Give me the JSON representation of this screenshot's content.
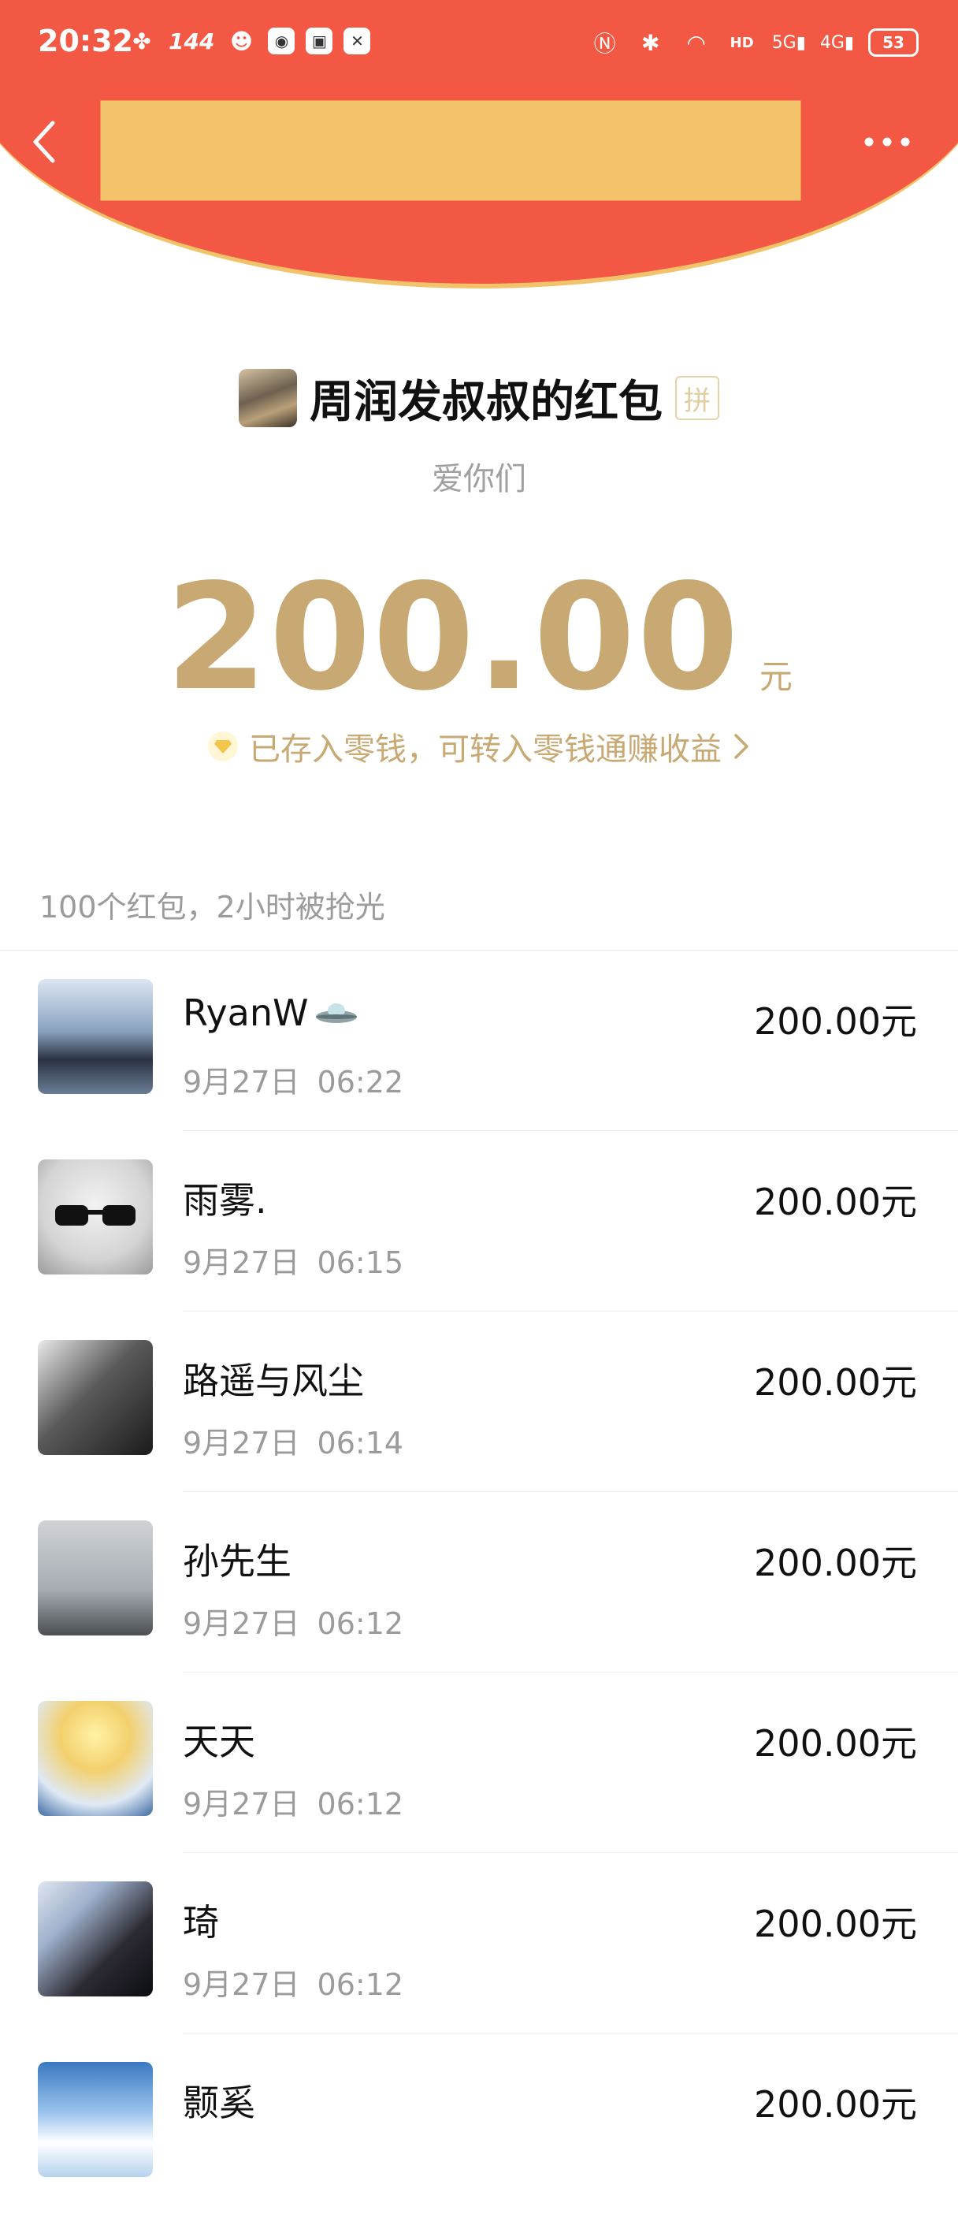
{
  "status_bar": {
    "time": "20:32",
    "refresh_rate": "144",
    "battery": "53",
    "signal_5g": "5G",
    "signal_4g": "4G"
  },
  "header": {
    "sender_title": "周润发叔叔的红包",
    "pin_badge": "拼",
    "greeting": "爱你们"
  },
  "amount": {
    "value": "200.00",
    "unit": "元",
    "stored_note": "已存入零钱，可转入零钱通赚收益"
  },
  "list": {
    "summary": "100个红包，2小时被抢光",
    "items": [
      {
        "name": "RyanW",
        "badge": "ufo-icon",
        "date": "9月27日",
        "time": "06:22",
        "amount": "200.00元"
      },
      {
        "name": "雨雾.",
        "date": "9月27日",
        "time": "06:15",
        "amount": "200.00元"
      },
      {
        "name": "路遥与风尘",
        "date": "9月27日",
        "time": "06:14",
        "amount": "200.00元"
      },
      {
        "name": "孙先生",
        "date": "9月27日",
        "time": "06:12",
        "amount": "200.00元"
      },
      {
        "name": "天天",
        "date": "9月27日",
        "time": "06:12",
        "amount": "200.00元"
      },
      {
        "name": "琦",
        "date": "9月27日",
        "time": "06:12",
        "amount": "200.00元"
      },
      {
        "name": "颢奚",
        "date": "",
        "time": "",
        "amount": "200.00元"
      }
    ]
  },
  "colors": {
    "header_red": "#f25843",
    "gold": "#c8a873",
    "border_gold": "#f2c36a"
  }
}
